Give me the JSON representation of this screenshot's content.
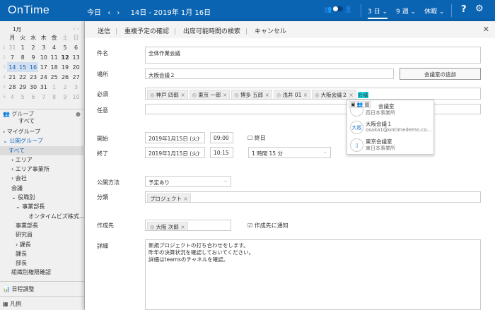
{
  "header": {
    "logo": "OnTime",
    "today": "今日",
    "prev": "‹",
    "next": "›",
    "range": "14日 - 2019年 1月 16日",
    "view_3day": "3 日",
    "view_9week": "9 週",
    "holiday": "休暇",
    "help": "?",
    "settings": "⚙"
  },
  "calendar": {
    "month": "1月",
    "weekdays": [
      "月",
      "火",
      "水",
      "木",
      "金",
      "土",
      "日"
    ],
    "weeks": [
      {
        "n": "1",
        "d": [
          "31",
          "1",
          "2",
          "3",
          "4",
          "5",
          "6"
        ]
      },
      {
        "n": "2",
        "d": [
          "7",
          "8",
          "9",
          "10",
          "11",
          "12",
          "13"
        ]
      },
      {
        "n": "3",
        "d": [
          "14",
          "15",
          "16",
          "17",
          "18",
          "19",
          "20"
        ]
      },
      {
        "n": "4",
        "d": [
          "21",
          "22",
          "23",
          "24",
          "25",
          "26",
          "27"
        ]
      },
      {
        "n": "5",
        "d": [
          "28",
          "29",
          "30",
          "31",
          "1",
          "2",
          "3"
        ]
      },
      {
        "n": "6",
        "d": [
          "4",
          "5",
          "6",
          "7",
          "8",
          "9",
          "10"
        ]
      }
    ]
  },
  "groups": {
    "title": "グループ",
    "subtitle": "すべて",
    "items": [
      "› マイグループ",
      "⌄ 公開グループ",
      "すべて",
      "› エリア",
      "› エリア事業所",
      "› 会社",
      "会議",
      "⌄ 役職別",
      "⌄ 事業部長",
      "オンタイムビズ株式...",
      "事業部長",
      "研究員",
      "› 課長",
      "課長",
      "部長",
      "組織別権限確認"
    ],
    "schedule": "日程調整",
    "legend": "凡例"
  },
  "toolbar": {
    "send": "送信",
    "check": "重複予定の確認",
    "search": "出席可能時間の検索",
    "cancel": "キャンセル",
    "close": "✕"
  },
  "form": {
    "subject_label": "件名",
    "subject": "全体作業会議",
    "place_label": "場所",
    "place": "大阪会議２",
    "add_room": "会議室の追加",
    "required_label": "必須",
    "required": [
      "神戸 四郎",
      "東京 一郎",
      "博多 五郎",
      "浅井 01",
      "大阪会議２"
    ],
    "required_input": "会議",
    "optional_label": "任意",
    "start_label": "開始",
    "start_date": "2019年1月15日 (火)",
    "start_time": "09:00",
    "allday": "終日",
    "end_label": "終了",
    "end_date": "2019年1月15日 (火)",
    "end_time": "10:15",
    "duration": "1 時間 15 分",
    "visibility_label": "公開方法",
    "visibility": "予定あり",
    "category_label": "分類",
    "category": "プロジェクト",
    "author_label": "作成先",
    "author": "大阪 次郎",
    "notify": "作成先に通知",
    "detail_label": "詳細",
    "detail": "新規プロジェクトの打ち合わせをします。\n昨年の決算状況を確認しておいてください。\n詳細はteamsのチャネルを確認。"
  },
  "suggestions": [
    {
      "name": "会議室",
      "sub": "西日本事業所",
      "avatar": ""
    },
    {
      "name": "大阪会議１",
      "sub": "osaka1@ontimedemo.co...",
      "avatar": "大阪"
    },
    {
      "name": "東京会議室",
      "sub": "東日本事業所",
      "avatar": "▯"
    }
  ]
}
